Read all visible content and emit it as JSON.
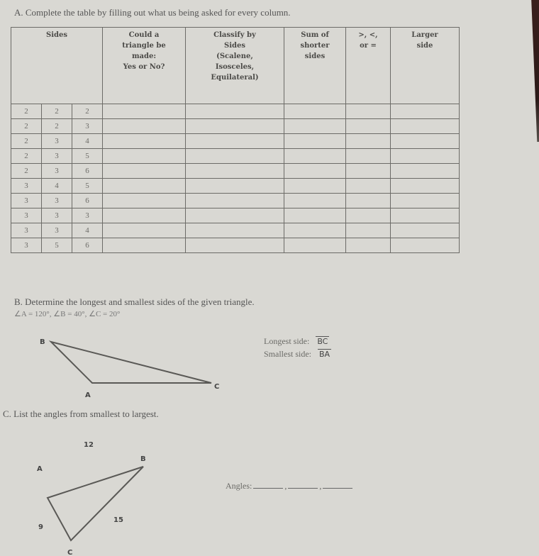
{
  "part_a": {
    "instruction": "A. Complete the table by filling out what us being asked for every column.",
    "headers": [
      "Sides",
      "Could a triangle be made: Yes or No?",
      "Classify by Sides (Scalene, Isosceles, Equilateral)",
      "Sum of shorter sides",
      ">, <, or =",
      "Larger side"
    ],
    "header_lines": [
      [
        "Sides"
      ],
      [
        "Could a",
        "triangle be",
        "made:",
        "Yes or No?"
      ],
      [
        "Classify by",
        "Sides",
        "(Scalene,",
        "Isosceles,",
        "Equilateral)"
      ],
      [
        "Sum of",
        "shorter",
        "sides"
      ],
      [
        ">, <,",
        "or ="
      ],
      [
        "Larger",
        "side"
      ]
    ],
    "rows": [
      [
        "2",
        "2",
        "2"
      ],
      [
        "2",
        "2",
        "3"
      ],
      [
        "2",
        "3",
        "4"
      ],
      [
        "2",
        "3",
        "5"
      ],
      [
        "2",
        "3",
        "6"
      ],
      [
        "3",
        "4",
        "5"
      ],
      [
        "3",
        "3",
        "6"
      ],
      [
        "3",
        "3",
        "3"
      ],
      [
        "3",
        "3",
        "4"
      ],
      [
        "3",
        "5",
        "6"
      ]
    ]
  },
  "part_b": {
    "instruction": "B. Determine the longest and smallest sides of the given triangle.",
    "angles": "∠A = 120°,  ∠B = 40°,  ∠C = 20°",
    "vertex_labels": {
      "a": "A",
      "b": "B",
      "c": "C"
    },
    "longest_label": "Longest side:",
    "longest_answer": "BC",
    "smallest_label": "Smallest side:",
    "smallest_answer": "BA"
  },
  "part_c": {
    "instruction": "C. List the angles from smallest to largest.",
    "vertex_labels": {
      "a": "A",
      "b": "B",
      "c": "C"
    },
    "side_labels": {
      "ab": "12",
      "ac": "9",
      "bc": "15"
    },
    "angles_label": "Angles:",
    "separator": ","
  }
}
